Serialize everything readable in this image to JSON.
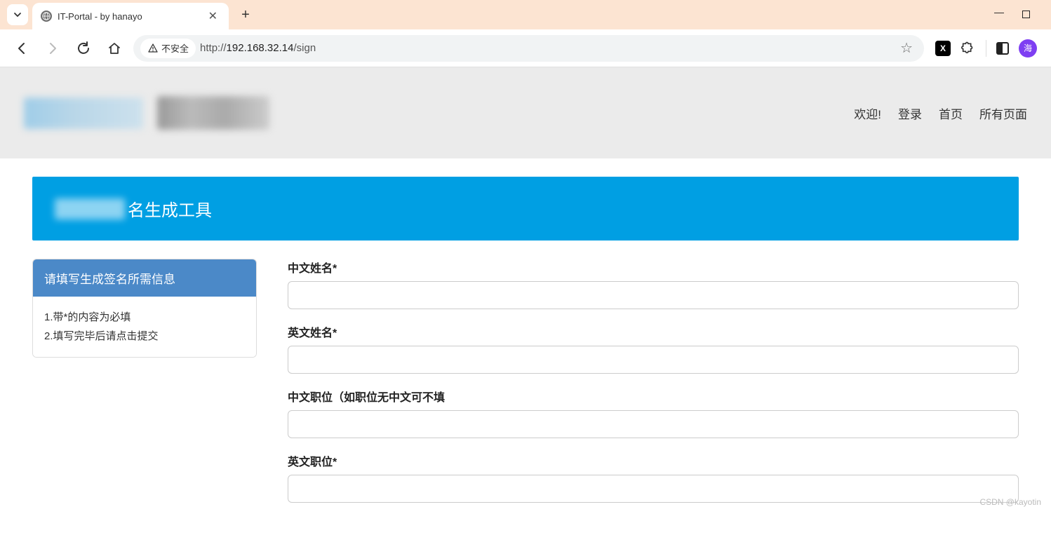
{
  "browser": {
    "tab_title": "IT-Portal - by hanayo",
    "security_label": "不安全",
    "url_scheme": "http://",
    "url_host": "192.168.32.14",
    "url_path": "/sign",
    "avatar_text": "海"
  },
  "header": {
    "nav": {
      "welcome": "欢迎!",
      "login": "登录",
      "home": "首页",
      "all_pages": "所有页面"
    }
  },
  "banner": {
    "title_suffix": "名生成工具"
  },
  "side_panel": {
    "title": "请填写生成签名所需信息",
    "note1": "1.带*的内容为必填",
    "note2": "2.填写完毕后请点击提交"
  },
  "form": {
    "cn_name_label": "中文姓名*",
    "en_name_label": "英文姓名*",
    "cn_title_label": "中文职位（如职位无中文可不填",
    "en_title_label": "英文职位*",
    "cn_name_value": "",
    "en_name_value": "",
    "cn_title_value": "",
    "en_title_value": ""
  },
  "watermark": "CSDN @kayotin"
}
